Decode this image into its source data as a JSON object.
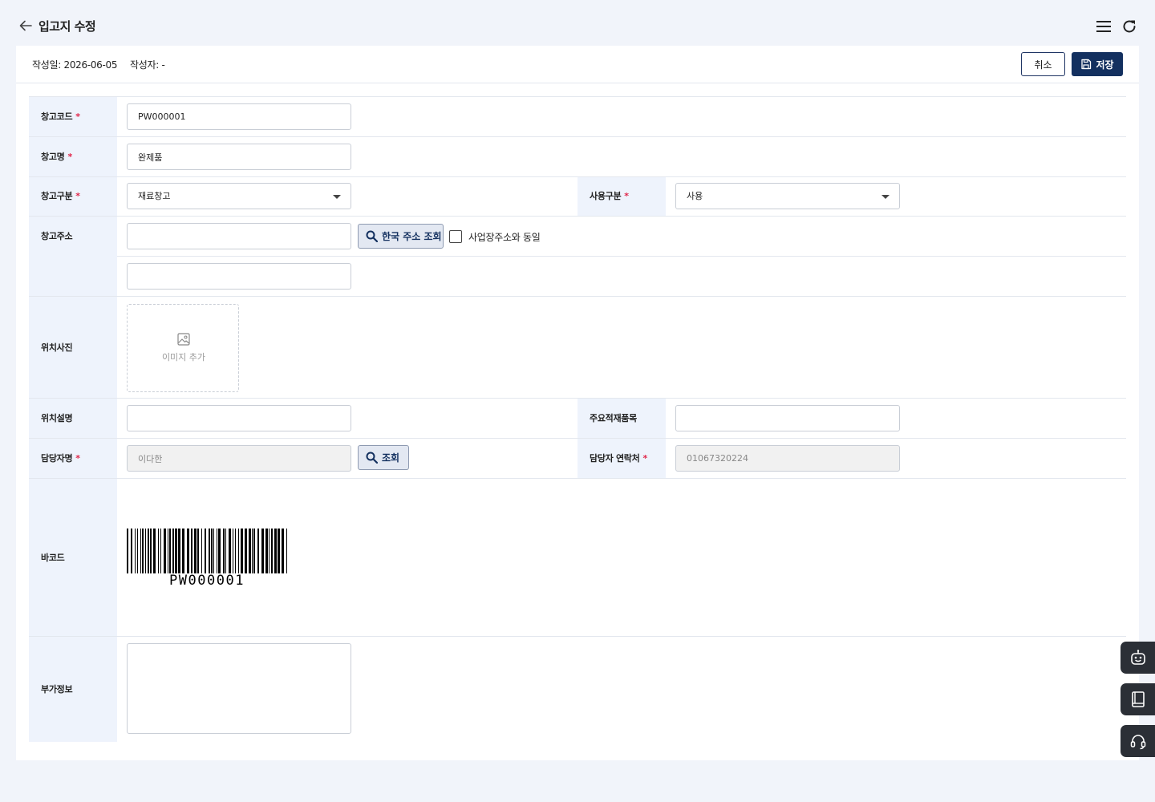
{
  "header": {
    "title": "입고지 수정"
  },
  "meta": {
    "created": "작성일: 2026-06-05",
    "author": "작성자: -"
  },
  "actions": {
    "cancel": "취소",
    "save": "저장"
  },
  "required_mark": "*",
  "form": {
    "warehouse_code": {
      "label": "창고코드",
      "value": "PW000001"
    },
    "warehouse_name": {
      "label": "창고명",
      "value": "완제품"
    },
    "warehouse_type": {
      "label": "창고구분",
      "value": "재료창고"
    },
    "usage_type": {
      "label": "사용구분",
      "value": "사용"
    },
    "address": {
      "label": "창고주소",
      "line1": "",
      "line2": "",
      "search_button": "한국 주소 조회",
      "same_as_business": "사업장주소와 동일"
    },
    "location_photo": {
      "label": "위치사진",
      "add_image": "이미지 추가"
    },
    "location_desc": {
      "label": "위치설명",
      "value": ""
    },
    "main_items": {
      "label": "주요적재품목",
      "value": ""
    },
    "manager_name": {
      "label": "담당자명",
      "value": "이다한",
      "search_button": "조회"
    },
    "manager_contact": {
      "label": "담당자 연락처",
      "value": "01067320224"
    },
    "barcode": {
      "label": "바코드",
      "value": "PW000001"
    },
    "extra_info": {
      "label": "부가정보",
      "value": ""
    }
  },
  "icons": {
    "back": "arrow-left-icon",
    "menu": "hamburger-menu-icon",
    "refresh": "refresh-icon",
    "save": "floppy-disk-icon",
    "search": "magnifier-icon",
    "image": "image-icon",
    "chatbot": "robot-icon",
    "manual": "book-icon",
    "support": "headset-icon"
  },
  "colors": {
    "primary": "#13305f",
    "label_bg": "#eef3fc",
    "required": "#e0264a",
    "page_bg": "#f1f4fa",
    "float_bg": "#2b2f36"
  }
}
